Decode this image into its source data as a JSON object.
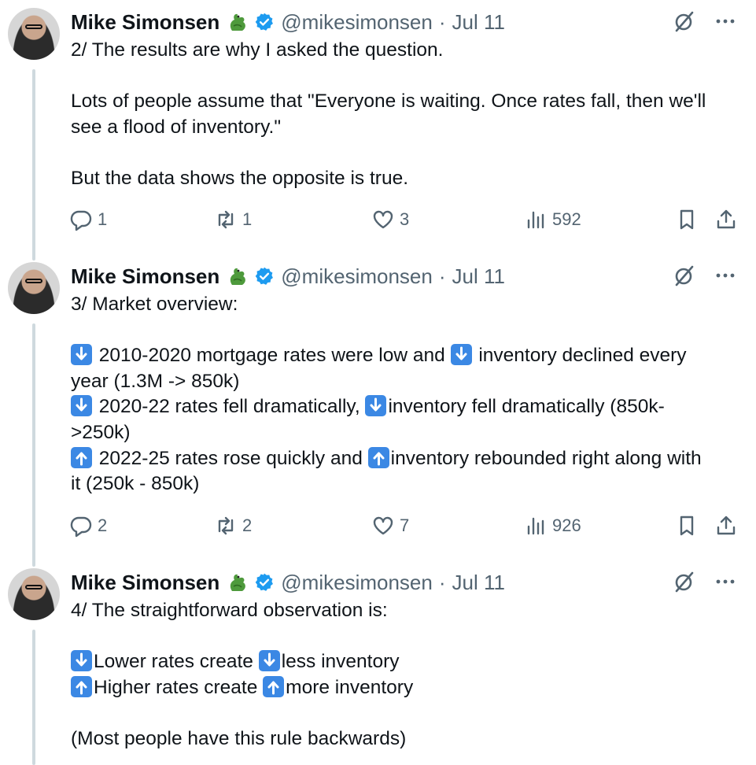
{
  "tweets": [
    {
      "name": "Mike Simonsen",
      "handle": "@mikesimonsen",
      "separator": "·",
      "date": "Jul 11",
      "lines": [
        [
          {
            "t": "2/ The results are why I asked the question."
          }
        ],
        [],
        [
          {
            "t": "Lots of people assume that \"Everyone is waiting. Once rates fall, then we'll"
          }
        ],
        [
          {
            "t": "see a flood of inventory.\""
          }
        ],
        [],
        [
          {
            "t": "But the data shows the opposite is true."
          }
        ]
      ],
      "replies": "1",
      "reposts": "1",
      "likes": "3",
      "views": "592"
    },
    {
      "name": "Mike Simonsen",
      "handle": "@mikesimonsen",
      "separator": "·",
      "date": "Jul 11",
      "lines": [
        [
          {
            "t": "3/ Market overview:"
          }
        ],
        [],
        [
          {
            "e": "down"
          },
          {
            "t": " 2010-2020 mortgage rates were low and "
          },
          {
            "e": "down"
          },
          {
            "t": " inventory declined every"
          }
        ],
        [
          {
            "t": "year (1.3M -> 850k)"
          }
        ],
        [
          {
            "e": "down"
          },
          {
            "t": " 2020-22 rates fell dramatically, "
          },
          {
            "e": "down"
          },
          {
            "t": "inventory fell dramatically (850k-"
          }
        ],
        [
          {
            "t": ">250k)"
          }
        ],
        [
          {
            "e": "up"
          },
          {
            "t": " 2022-25 rates rose quickly and "
          },
          {
            "e": "up"
          },
          {
            "t": "inventory rebounded right along with"
          }
        ],
        [
          {
            "t": "it (250k - 850k)"
          }
        ]
      ],
      "replies": "2",
      "reposts": "2",
      "likes": "7",
      "views": "926"
    },
    {
      "name": "Mike Simonsen",
      "handle": "@mikesimonsen",
      "separator": "·",
      "date": "Jul 11",
      "lines": [
        [
          {
            "t": "4/ The straightforward observation is:"
          }
        ],
        [],
        [
          {
            "e": "down"
          },
          {
            "t": "Lower rates create "
          },
          {
            "e": "down"
          },
          {
            "t": "less inventory"
          }
        ],
        [
          {
            "e": "up"
          },
          {
            "t": "Higher rates create "
          },
          {
            "e": "up"
          },
          {
            "t": "more inventory"
          }
        ],
        [],
        [
          {
            "t": "(Most people have this rule backwards)"
          }
        ]
      ]
    }
  ],
  "icons": {
    "emoji": "dragon-emoji",
    "verified": "verified-badge-icon",
    "grok": "grok-icon",
    "more": "more-icon",
    "reply": "reply-icon",
    "repost": "repost-icon",
    "like": "like-icon",
    "views": "views-icon",
    "bookmark": "bookmark-icon",
    "share": "share-icon"
  },
  "colors": {
    "text": "#0f1419",
    "secondary": "#536471",
    "verified": "#1d9bf0",
    "arrow_emoji": "#3b88e4",
    "thread_line": "#cfd9de"
  }
}
